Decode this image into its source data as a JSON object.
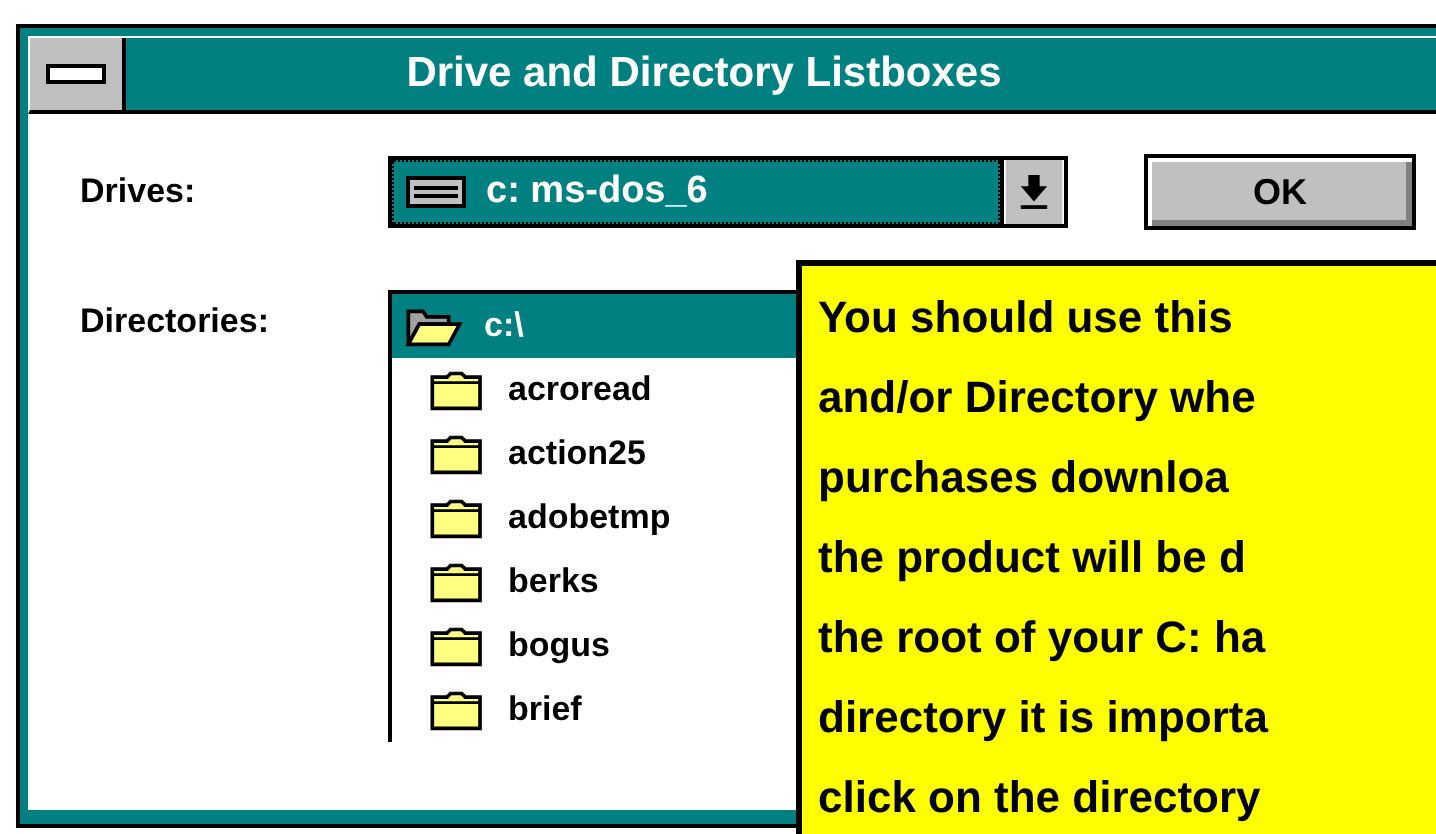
{
  "window": {
    "title": "Drive and Directory Listboxes"
  },
  "drives": {
    "label": "Drives:",
    "value": "c:  ms-dos_6",
    "selected": true
  },
  "ok_button": "OK",
  "directories": {
    "label": "Directories:",
    "items": [
      {
        "name": "c:\\",
        "selected": true,
        "children": [
          {
            "name": "acroread",
            "selected": false
          },
          {
            "name": "action25",
            "selected": false
          },
          {
            "name": "adobetmp",
            "selected": false
          },
          {
            "name": "berks",
            "selected": false
          },
          {
            "name": "bogus",
            "selected": false
          },
          {
            "name": "brief",
            "selected": false
          }
        ]
      }
    ]
  },
  "tooltip": {
    "lines": [
      "You should use this",
      "and/or Directory whe",
      "purchases downloa",
      "the product will be d",
      "the root of your C: ha",
      "directory it is importa",
      "click on the directory"
    ]
  }
}
